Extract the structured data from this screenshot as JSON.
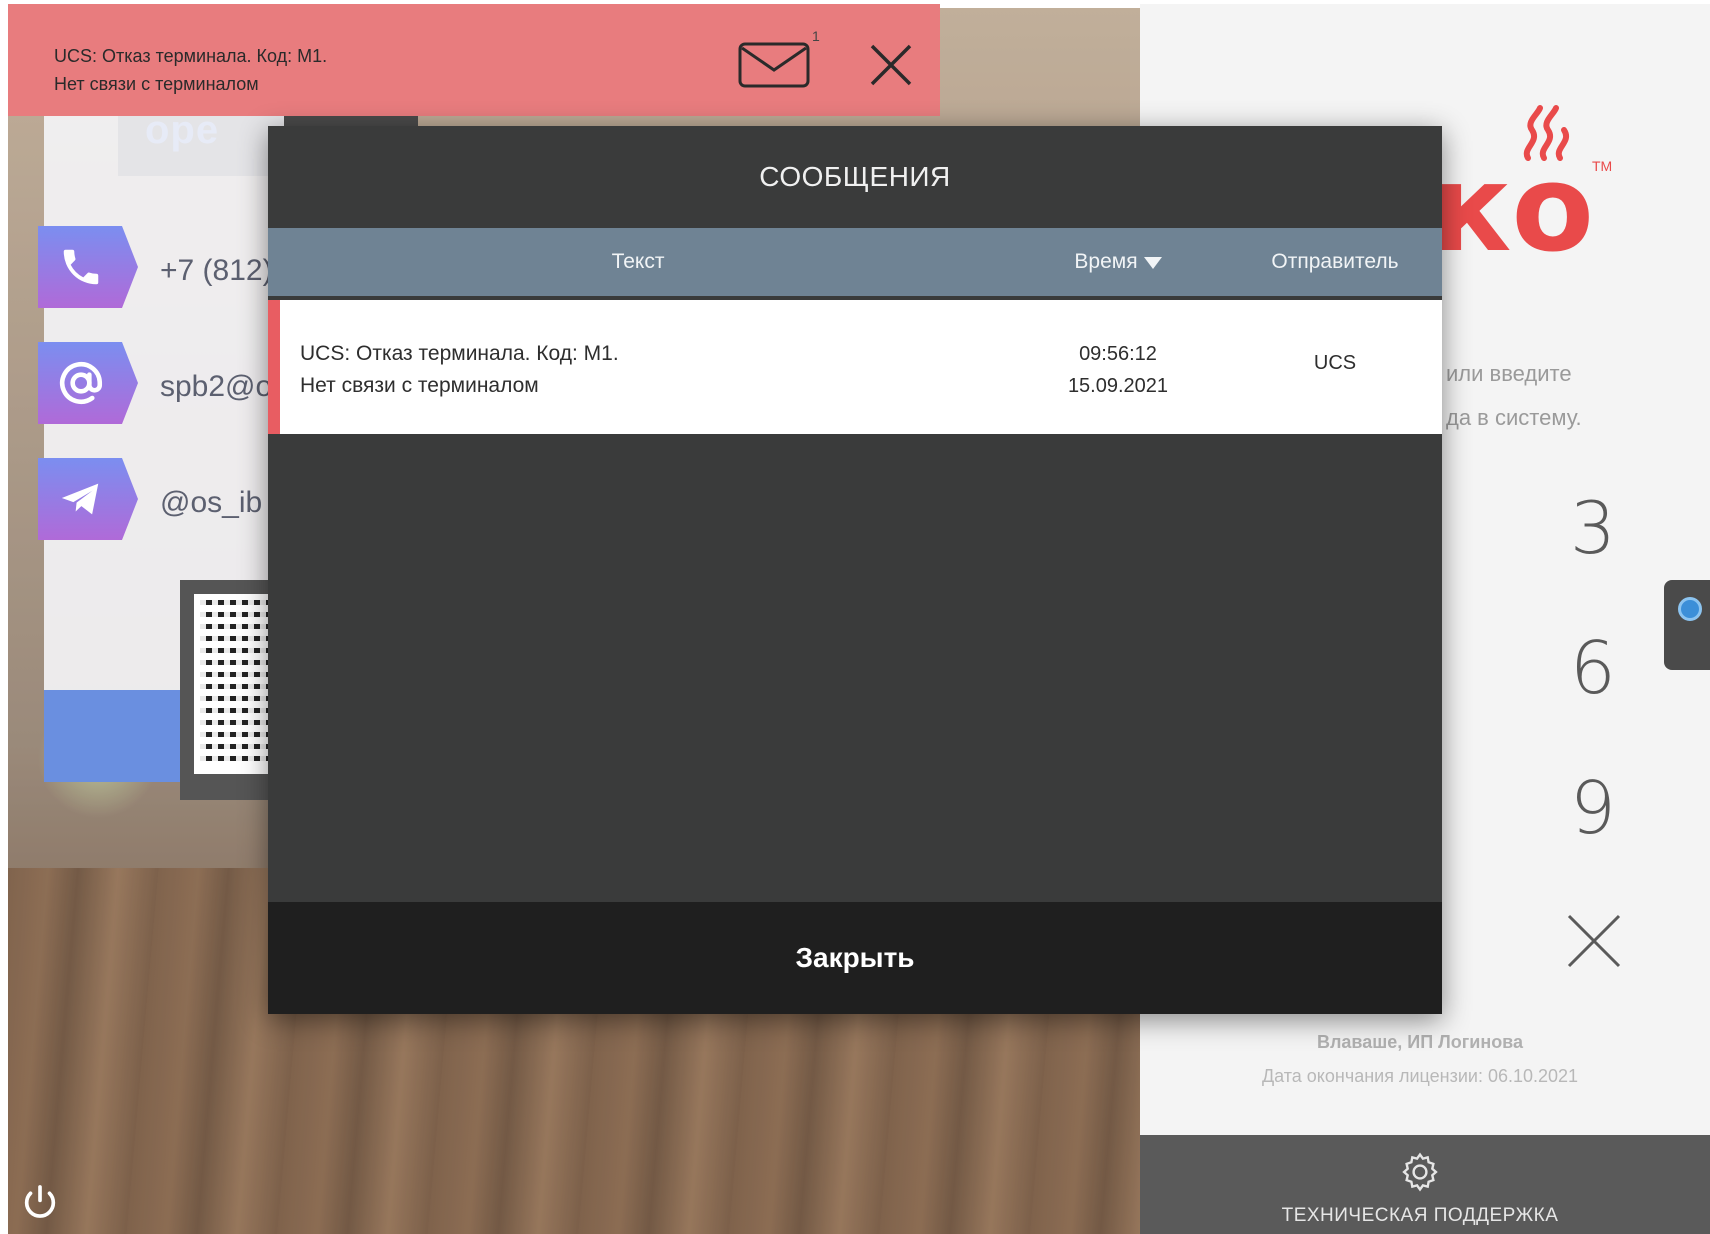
{
  "notification": {
    "line1": "UCS: Отказ терминала. Код: M1.",
    "line2": "Нет связи с терминалом",
    "unread_count": "1",
    "icons": {
      "mail": "envelope-icon",
      "close": "close-icon"
    }
  },
  "background": {
    "logo_text": "ope",
    "contacts": [
      {
        "icon": "phone-icon",
        "text": "+7 (812)"
      },
      {
        "icon": "at-sign-icon",
        "text": "spb2@o"
      },
      {
        "icon": "telegram-icon",
        "text": "@os_ib"
      }
    ]
  },
  "login_panel": {
    "brand_logo": "ко",
    "brand_tm": "TM",
    "hint_line1": "или введите",
    "hint_line2": "да в систему.",
    "numpad_digits": [
      "3",
      "6",
      "9"
    ],
    "company": "Влаваше, ИП Логинова",
    "license": "Дата окончания лицензии: 06.10.2021",
    "support_label": "ТЕХНИЧЕСКАЯ ПОДДЕРЖКА"
  },
  "modal": {
    "title": "СООБЩЕНИЯ",
    "columns": {
      "text": "Текст",
      "time": "Время",
      "sender": "Отправитель"
    },
    "rows": [
      {
        "text_line1": "UCS: Отказ терминала. Код: M1.",
        "text_line2": "Нет связи с терминалом",
        "time": "09:56:12",
        "date": "15.09.2021",
        "sender": "UCS"
      }
    ],
    "close_label": "Закрыть"
  },
  "colors": {
    "notify_bg": "#e87c7e",
    "modal_bg": "#3a3b3b",
    "header_bg": "#6f8394",
    "row_accent": "#e85d62",
    "footer_bg": "#1f1f1f",
    "brand": "#e94a4a"
  }
}
